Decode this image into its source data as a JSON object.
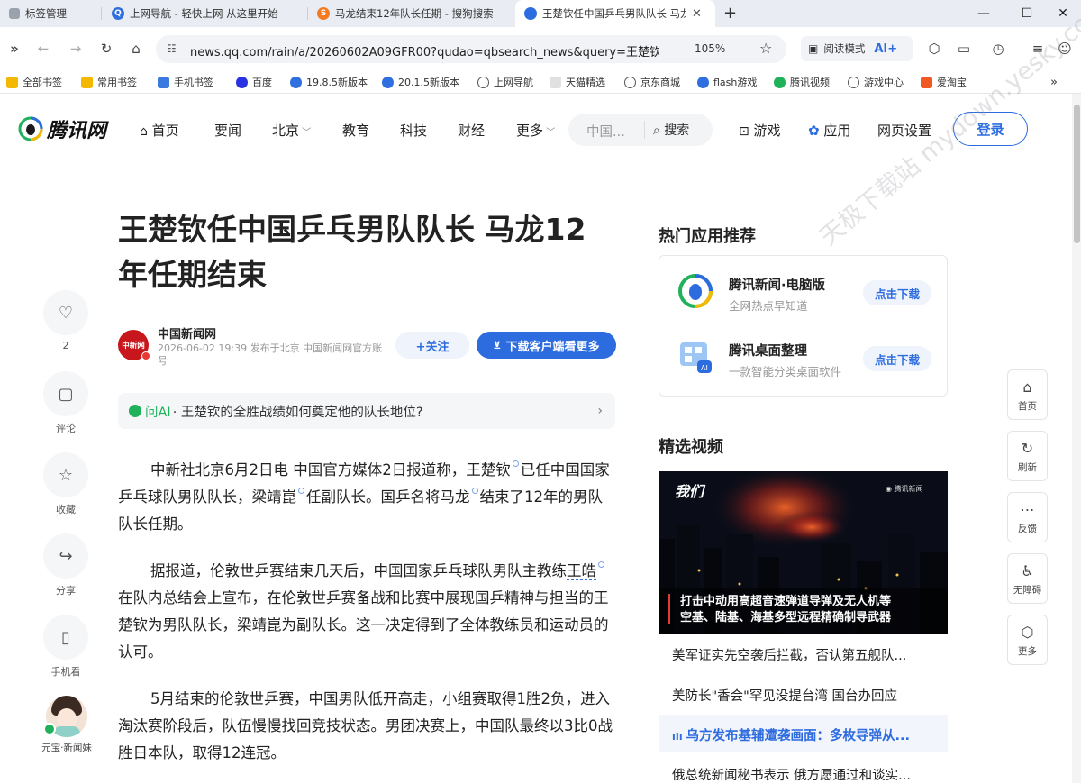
{
  "browser": {
    "tabs": [
      {
        "label": "标签管理"
      },
      {
        "label": "上网导航 - 轻快上网 从这里开始"
      },
      {
        "label": "马龙结束12年队长任期 - 搜狗搜索"
      },
      {
        "label": "王楚钦任中国乒乓男队队长 马龙"
      }
    ],
    "new_tab": "+",
    "url": "news.qq.com/rain/a/20260602A09GFR00?qudao=qbsearch_news&query=王楚钦任...",
    "zoom": "105%",
    "read_mode": "阅读模式",
    "ai_label": "AI+",
    "bookmarks": [
      "全部书签",
      "常用书签",
      "手机书签",
      "百度",
      "19.8.5新版本",
      "20.1.5新版本",
      "上网导航",
      "天猫精选",
      "京东商城",
      "flash游戏",
      "腾讯视频",
      "游戏中心",
      "爱淘宝"
    ]
  },
  "site": {
    "logo": "腾讯网",
    "nav": [
      "首页",
      "要闻",
      "北京",
      "教育",
      "科技",
      "财经",
      "更多"
    ],
    "search_placeholder": "中国...",
    "search_btn": "搜索",
    "games": "游戏",
    "apps": "应用",
    "settings": "网页设置",
    "login": "登录"
  },
  "left_actions": [
    {
      "label": "2"
    },
    {
      "label": "评论"
    },
    {
      "label": "收藏"
    },
    {
      "label": "分享"
    },
    {
      "label": "手机看"
    },
    {
      "label": "元宝·新闻妹"
    }
  ],
  "article": {
    "title": "王楚钦任中国乒乓男队队长 马龙12年任期结束",
    "author_logo": "中新网",
    "author": "中国新闻网",
    "meta": "2026-06-02 19:39 发布于北京 中国新闻网官方账号",
    "follow": "+关注",
    "download": "下载客户端看更多",
    "ai_prefix": "问AI",
    "ai_question": "· 王楚钦的全胜战绩如何奠定他的队长地位?",
    "p1": {
      "a": "中新社北京6月2日电 中国官方媒体2日报道称，",
      "k1": "王楚钦",
      "b": "已任中国国家乒乓球队男队队长，",
      "k2": "梁靖崑",
      "c": "任副队长。国乒名将",
      "k3": "马龙",
      "d": "结束了12年的男队队长任期。"
    },
    "p2": {
      "a": "据报道，伦敦世乒赛结束几天后，中国国家乒乓球队男队主教练",
      "k1": "王皓",
      "b": "在队内总结会上宣布，在伦敦世乒赛备战和比赛中展现国乒精神与担当的王楚钦为男队队长，梁靖崑为副队长。这一决定得到了全体教练员和运动员的认可。"
    },
    "p3": "5月结束的伦敦世乒赛，中国男队低开高走，小组赛取得1胜2负，进入淘汰赛阶段后，队伍慢慢找回竞技状态。男团决赛上，中国队最终以3比0战胜日本队，取得12连冠。"
  },
  "sidebar": {
    "apps_title": "热门应用推荐",
    "apps": [
      {
        "name": "腾讯新闻·电脑版",
        "desc": "全网热点早知道",
        "btn": "点击下载"
      },
      {
        "name": "腾讯桌面整理",
        "desc": "一款智能分类桌面软件",
        "btn": "点击下载"
      }
    ],
    "videos_title": "精选视频",
    "video_caption_1": "打击中动用高超音速弹道导弹及无人机等",
    "video_caption_2": "空基、陆基、海基多型远程精确制导武器",
    "video_badge": "我们",
    "video_brand": "腾讯新闻",
    "video_items": [
      "美军证实先空袭后拦截，否认第五舰队...",
      "美防长\"香会\"罕见没提台湾 国台办回应",
      "乌方发布基辅遭袭画面：多枚导弹从...",
      "俄总统新闻秘书表示 俄方愿通过和谈实..."
    ]
  },
  "float_tools": [
    "首页",
    "刷新",
    "反馈",
    "无障碍",
    "更多"
  ],
  "watermark": "天极下载站 mydown.yesky.com",
  "colors": {
    "accent": "#2d6cdf",
    "title": "#222222",
    "muted": "#999999"
  }
}
